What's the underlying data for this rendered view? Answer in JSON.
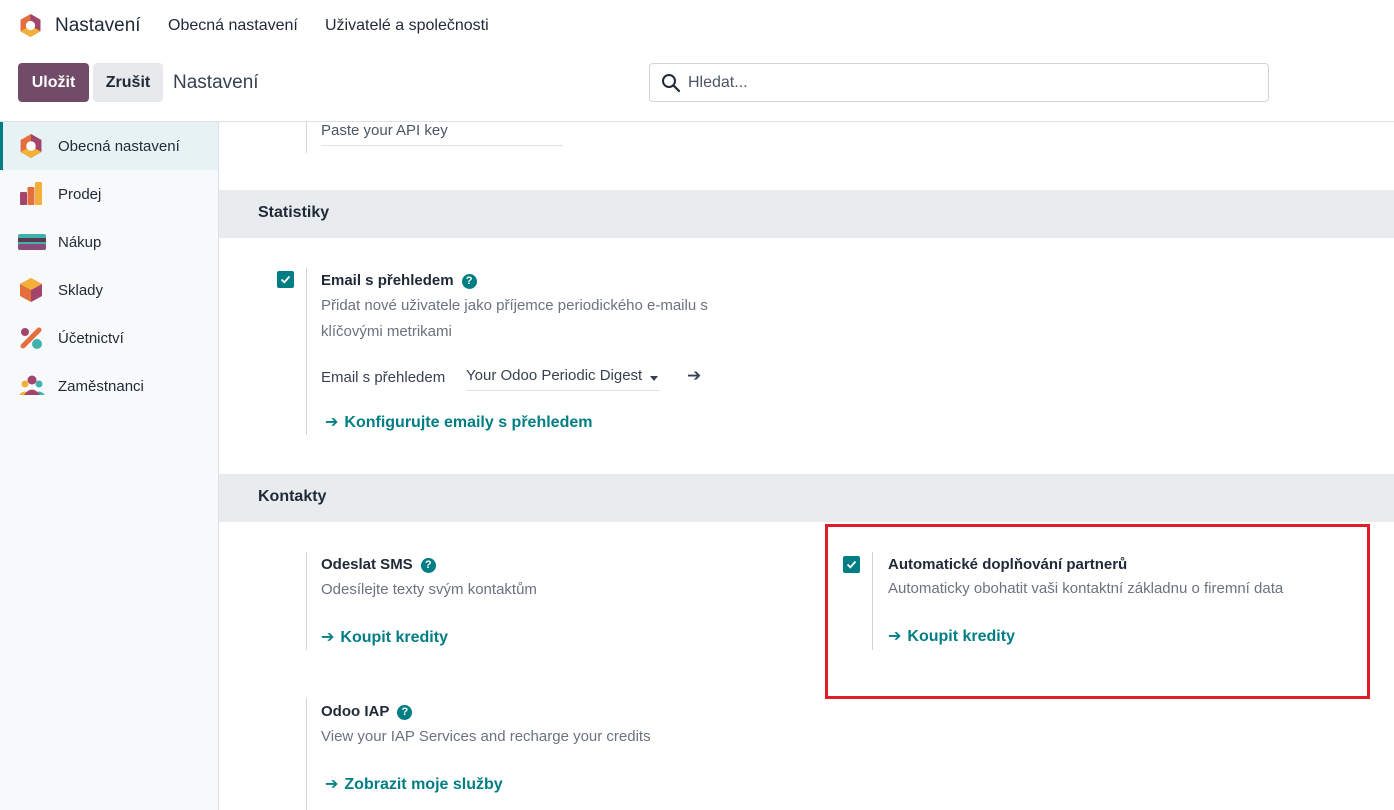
{
  "topnav": {
    "app_name": "Nastavení",
    "links": [
      "Obecná nastavení",
      "Uživatelé a společnosti"
    ]
  },
  "controls": {
    "save_label": "Uložit",
    "cancel_label": "Zrušit",
    "title": "Nastavení",
    "search_placeholder": "Hledat..."
  },
  "sidebar": {
    "items": [
      {
        "label": "Obecná nastavení",
        "icon": "settings-app-icon",
        "active": true
      },
      {
        "label": "Prodej",
        "icon": "sales-app-icon",
        "active": false
      },
      {
        "label": "Nákup",
        "icon": "purchase-app-icon",
        "active": false
      },
      {
        "label": "Sklady",
        "icon": "inventory-app-icon",
        "active": false
      },
      {
        "label": "Účetnictví",
        "icon": "accounting-app-icon",
        "active": false
      },
      {
        "label": "Zaměstnanci",
        "icon": "employees-app-icon",
        "active": false
      }
    ]
  },
  "main": {
    "api_key_placeholder": "Paste your API key",
    "statistiky": {
      "heading": "Statistiky",
      "digest": {
        "title": "Email s přehledem",
        "checked": true,
        "description": "Přidat nové uživatele jako příjemce periodického e-mailu s klíčovými metrikami",
        "field_label": "Email s přehledem",
        "field_value": "Your Odoo Periodic Digest",
        "link": "Konfigurujte emaily s přehledem"
      }
    },
    "kontakty": {
      "heading": "Kontakty",
      "sms": {
        "title": "Odeslat SMS",
        "description": "Odesílejte texty svým kontaktům",
        "link": "Koupit kredity"
      },
      "autocomplete": {
        "title": "Automatické doplňování partnerů",
        "checked": true,
        "description": "Automaticky obohatit vaši kontaktní základnu o firemní data",
        "link": "Koupit kredity"
      },
      "iap": {
        "title": "Odoo IAP",
        "description": "View your IAP Services and recharge your credits",
        "link": "Zobrazit moje služby"
      }
    }
  },
  "colors": {
    "brand": "#714b67",
    "accent": "#017e84",
    "highlight": "#e11d2a"
  }
}
